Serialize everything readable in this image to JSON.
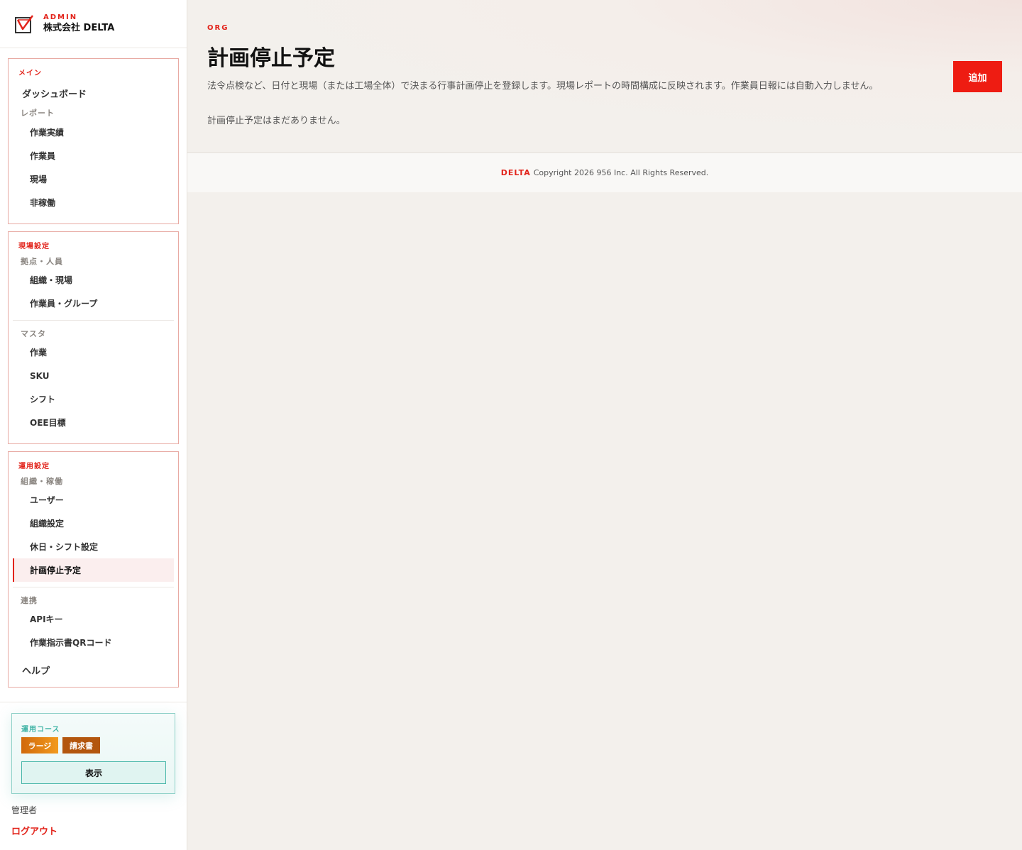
{
  "brand": {
    "tag": "ADMIN",
    "name": "株式会社 DELTA"
  },
  "nav": {
    "main": {
      "title": "メイン",
      "dashboard": "ダッシュボード",
      "reports_label": "レポート",
      "items": [
        "作業実績",
        "作業員",
        "現場",
        "非稼働"
      ]
    },
    "site_settings": {
      "title": "現場設定",
      "sub1_label": "拠点・人員",
      "sub1_items": [
        "組織・現場",
        "作業員・グループ"
      ],
      "sub2_label": "マスタ",
      "sub2_items": [
        "作業",
        "SKU",
        "シフト",
        "OEE目標"
      ]
    },
    "ops_settings": {
      "title": "運用設定",
      "sub1_label": "組織・稼働",
      "sub1_items": [
        "ユーザー",
        "組織設定",
        "休日・シフト設定",
        "計画停止予定"
      ],
      "sub2_label": "連携",
      "sub2_items": [
        "APIキー",
        "作業指示書QRコード"
      ],
      "help": "ヘルプ"
    }
  },
  "plan": {
    "title": "運用コース",
    "badges": [
      "ラージ",
      "請求書"
    ],
    "button": "表示"
  },
  "user": {
    "role": "管理者",
    "logout": "ログアウト"
  },
  "header": {
    "eyebrow": "ORG",
    "title": "計画停止予定",
    "description": "法令点検など、日付と現場（または工場全体）で決まる行事計画停止を登録します。現場レポートの時間構成に反映されます。作業員日報には自動入力しません。",
    "empty": "計画停止予定はまだありません。",
    "add_button": "追加"
  },
  "footer": {
    "brand": "DELTA",
    "copyright": "Copyright 2026 956 Inc. All Rights Reserved."
  },
  "colors": {
    "accent": "#e2231a",
    "teal": "#3fb3a5"
  }
}
